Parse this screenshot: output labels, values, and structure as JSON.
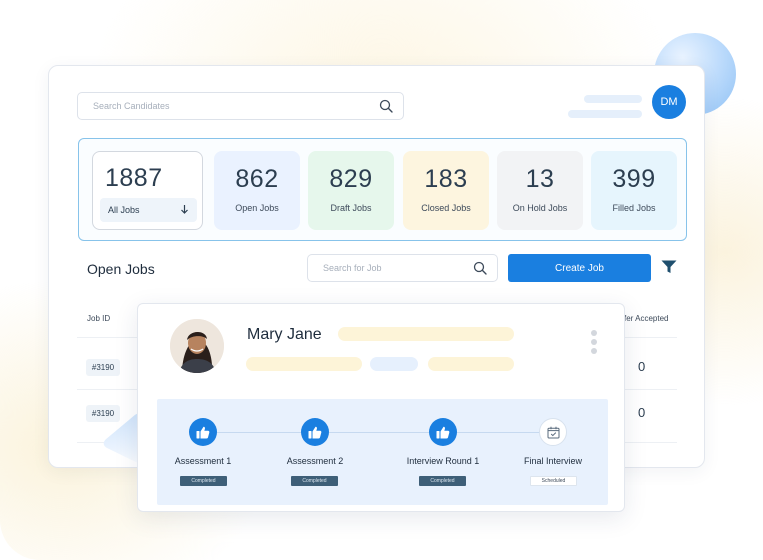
{
  "search": {
    "placeholder": "Search Candidates",
    "icon": "search-icon"
  },
  "user": {
    "initials": "DM"
  },
  "stats": [
    {
      "value": "1887",
      "label": "All Jobs",
      "color": "#ffffff"
    },
    {
      "value": "862",
      "label": "Open Jobs",
      "color": "#eaf2ff"
    },
    {
      "value": "829",
      "label": "Draft Jobs",
      "color": "#e6f7ec"
    },
    {
      "value": "183",
      "label": "Closed Jobs",
      "color": "#fdf5df"
    },
    {
      "value": "13",
      "label": "On Hold Jobs",
      "color": "#f2f3f5"
    },
    {
      "value": "399",
      "label": "Filled Jobs",
      "color": "#e6f5fd"
    }
  ],
  "jobs": {
    "title": "Open Jobs",
    "search_placeholder": "Search for Job",
    "create_label": "Create Job",
    "columns": {
      "job_id": "Job ID",
      "offer_accepted": "fer Accepted"
    },
    "rows": [
      {
        "id": "#3190",
        "offer_accepted": "0"
      },
      {
        "id": "#3190",
        "offer_accepted": "0"
      }
    ]
  },
  "candidate": {
    "name": "Mary Jane",
    "steps": [
      {
        "label": "Assessment 1",
        "status": "Completed",
        "icon": "thumbs-up-icon"
      },
      {
        "label": "Assessment 2",
        "status": "Completed",
        "icon": "thumbs-up-icon"
      },
      {
        "label": "Interview Round 1",
        "status": "Completed",
        "icon": "thumbs-up-icon"
      },
      {
        "label": "Final Interview",
        "status": "Scheduled",
        "icon": "calendar-check-icon"
      }
    ]
  },
  "colors": {
    "accent": "#1a7fe0",
    "badge_completed": "#3e5f78",
    "stats_border": "#87c3ea"
  }
}
